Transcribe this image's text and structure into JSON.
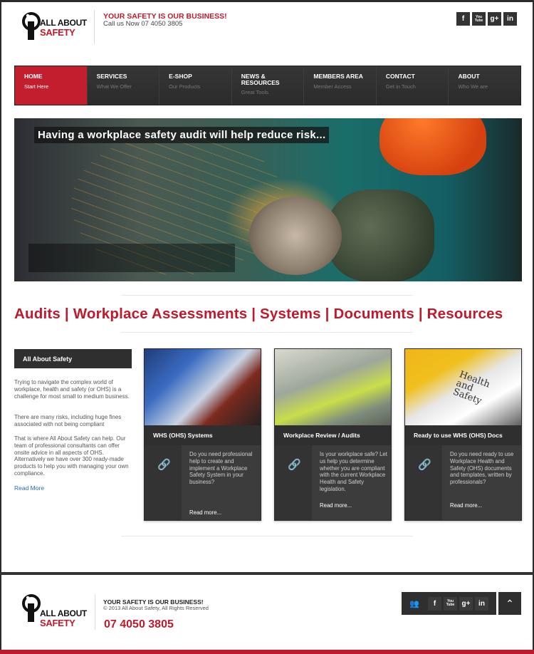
{
  "header": {
    "logo_line1": "ALL ABOUT",
    "logo_line2": "SAFETY",
    "tagline": "YOUR SAFETY IS OUR BUSINESS!",
    "phone_line": "Call us Now 07 4050 3805",
    "social": [
      "f",
      "You Tube",
      "g+",
      "in"
    ]
  },
  "nav": [
    {
      "label": "HOME",
      "sub": "Start Here"
    },
    {
      "label": "SERVICES",
      "sub": "What We Offer"
    },
    {
      "label": "E-SHOP",
      "sub": "Our Products"
    },
    {
      "label": "NEWS & RESOURCES",
      "sub": "Great Tools"
    },
    {
      "label": "MEMBERS AREA",
      "sub": "Member Access"
    },
    {
      "label": "CONTACT",
      "sub": "Get in Touch"
    },
    {
      "label": "ABOUT",
      "sub": "Who We are"
    }
  ],
  "hero": {
    "caption": "Having a workplace safety audit will help reduce risk..."
  },
  "headline": "Audits | Workplace Assessments | Systems | Documents | Resources",
  "sidebar": {
    "title": "All About Safety",
    "p1": "Trying to navigate the complex world of workplace, health and safety (or OHS) is a challenge for most small to medium business.",
    "p2": "There are many risks, including huge fines associated with not being compliant",
    "p3": "That is where All About Safety can help. Our team of professional consultants can offer onsite advice in all aspects of OHS. Alternatively we have over 300 ready-made products to help you with managing your own compliance.",
    "link": "Read More"
  },
  "cards": [
    {
      "title": "WHS (OHS) Systems",
      "desc": "Do you need professional help to create and implement a Workplace Safety System in your business?",
      "more": "Read more..."
    },
    {
      "title": "Workplace Review / Audits",
      "desc": "Is your workplace safe? Let us help you determine whether you are compliant with the current Workplace Health and Safety legislation.",
      "more": "Read more..."
    },
    {
      "title": "Ready to use WHS (OHS) Docs",
      "desc": "Do you need ready to use Workplace Health and Safety (OHS) documents and templates, written by professionals?",
      "more": "Read more...",
      "image_text": "Health and Safety"
    }
  ],
  "footer": {
    "tagline": "YOUR SAFETY IS OUR BUSINESS!",
    "copyright": "© 2013 All About Safety, All Rights Reserved",
    "phone": "07 4050 3805",
    "social": [
      "f",
      "You Tube",
      "g+",
      "in"
    ],
    "up_icon": "chevron-up-icon",
    "contact_icon": "contacts-icon"
  },
  "colors": {
    "brand_red": "#c0192b",
    "nav_dark": "#2f2f2f",
    "link_blue": "#1c6dbb"
  }
}
